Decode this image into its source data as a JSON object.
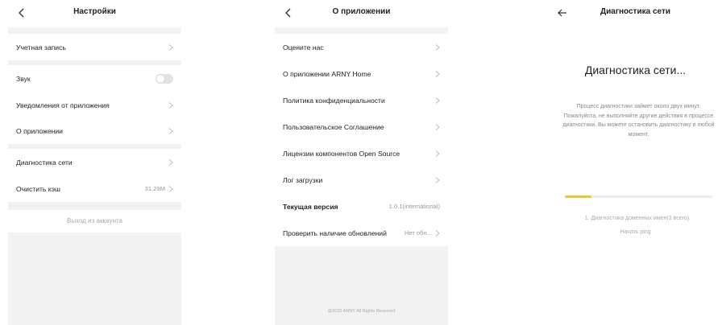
{
  "settings": {
    "title": "Настройки",
    "account": "Учетная запись",
    "sound": "Звук",
    "notifications": "Уведомления от приложения",
    "about": "О приложении",
    "network": "Диагностика сети",
    "cache": "Очистить кэш",
    "cache_size": "31.29M",
    "logout": "Выход из аккаунта"
  },
  "about": {
    "title": "О приложении",
    "rate": "Оцените нас",
    "about_app": "О приложении ARNY Home",
    "privacy": "Политика конфиденциальности",
    "agreement": "Пользовательское Соглашение",
    "licenses": "Лицензии компонентов Open Source",
    "log": "Лог загрузки",
    "version_label": "Текущая версия",
    "version_value": "1.0.1(international)",
    "update_label": "Проверить наличие обновлений",
    "update_value": "Нет обн...",
    "footer": "@2020 ARNY All Rights Reserved"
  },
  "diagnostics": {
    "title": "Диагностика сети",
    "heading": "Диагностика сети...",
    "description": "Процесс диагностики займет около двух минут. Пожалуйста, не выполняйте другие действия в процессе диагностики. Вы можете остановить диагностику в любой момент.",
    "progress": 0.18,
    "progress_color": "#f4c430",
    "step": "1. Диагностика доменных имен(3 всего)",
    "ping": "Начать ping"
  }
}
